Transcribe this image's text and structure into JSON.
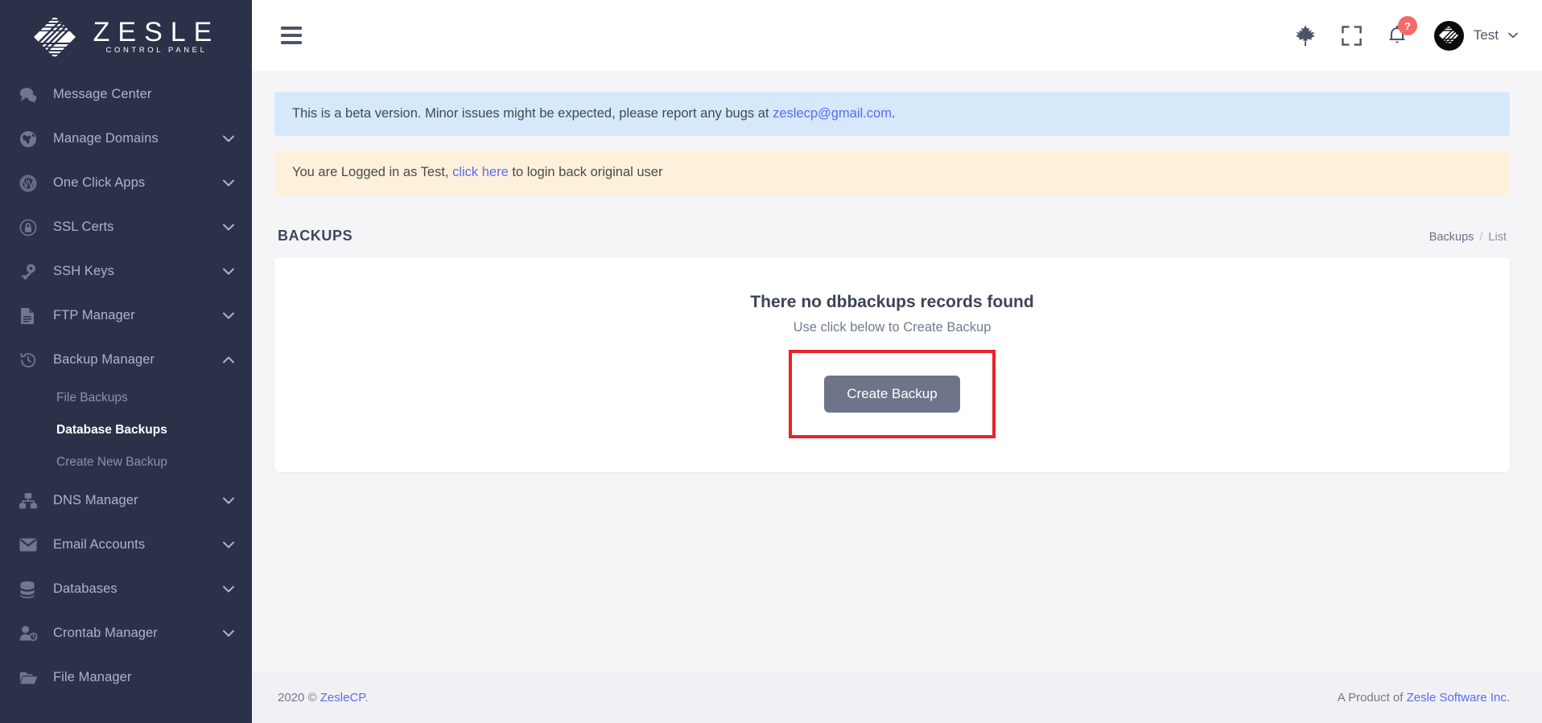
{
  "brand": {
    "title": "ZESLE",
    "subtitle": "CONTROL PANEL",
    "logo_icon": "zesle-diamond-logo"
  },
  "sidebar": {
    "items": [
      {
        "label": "Message Center",
        "icon": "chat-bubbles-icon",
        "caret": "",
        "expanded": false
      },
      {
        "label": "Manage Domains",
        "icon": "globe-icon",
        "caret": "⌄",
        "expanded": false
      },
      {
        "label": "One Click Apps",
        "icon": "wordpress-icon",
        "caret": "⌄",
        "expanded": false
      },
      {
        "label": "SSL Certs",
        "icon": "lock-shield-icon",
        "caret": "⌄",
        "expanded": false
      },
      {
        "label": "SSH Keys",
        "icon": "key-icon",
        "caret": "⌄",
        "expanded": false
      },
      {
        "label": "FTP Manager",
        "icon": "document-icon",
        "caret": "⌄",
        "expanded": false
      },
      {
        "label": "Backup Manager",
        "icon": "history-clock-icon",
        "caret": "⌃",
        "expanded": true
      },
      {
        "label": "DNS Manager",
        "icon": "sitemap-icon",
        "caret": "⌄",
        "expanded": false
      },
      {
        "label": "Email Accounts",
        "icon": "envelope-icon",
        "caret": "⌄",
        "expanded": false
      },
      {
        "label": "Databases",
        "icon": "database-icon",
        "caret": "⌄",
        "expanded": false
      },
      {
        "label": "Crontab Manager",
        "icon": "user-clock-icon",
        "caret": "⌄",
        "expanded": false
      },
      {
        "label": "File Manager",
        "icon": "folder-icon",
        "caret": "",
        "expanded": false
      }
    ],
    "backup_submenu": [
      {
        "label": "File Backups",
        "active": false
      },
      {
        "label": "Database Backups",
        "active": true
      },
      {
        "label": "Create New Backup",
        "active": false
      }
    ]
  },
  "topbar": {
    "menu_toggle_icon": "hamburger-icon",
    "flag_icon": "canada-maple-leaf-icon",
    "fullscreen_icon": "fullscreen-expand-icon",
    "notifications_icon": "bell-icon",
    "notifications_badge": "?",
    "avatar_icon": "zesle-avatar-logo",
    "user_name": "Test",
    "user_caret": "⌄"
  },
  "alerts": {
    "beta": {
      "text_before": "This is a beta version. Minor issues might be expected, please report any bugs at ",
      "link": "zeslecp@gmail.com",
      "text_after": "."
    },
    "impersonation": {
      "text_before": "You are Logged in as Test, ",
      "link": "click here",
      "text_after": " to login back original user"
    }
  },
  "page": {
    "title": "BACKUPS",
    "breadcrumb": {
      "parent": "Backups",
      "separator": "/",
      "current": "List"
    }
  },
  "empty_state": {
    "title": "There no dbbackups records found",
    "subtitle": "Use click below to Create Backup",
    "button_label": "Create Backup"
  },
  "footer": {
    "left_prefix": "2020 © ",
    "left_link": "ZesleCP",
    "left_suffix": ".",
    "right_prefix": "A Product of ",
    "right_link": "Zesle Software Inc",
    "right_suffix": "."
  },
  "colors": {
    "sidebar_bg": "#2b3148",
    "accent_link": "#5a6bf0",
    "alert_info_bg": "#d5e9fb",
    "alert_warn_bg": "#fdf1dc",
    "button_bg": "#6e7489",
    "highlight_border": "#e8222a",
    "badge_bg": "#f76a6a"
  }
}
